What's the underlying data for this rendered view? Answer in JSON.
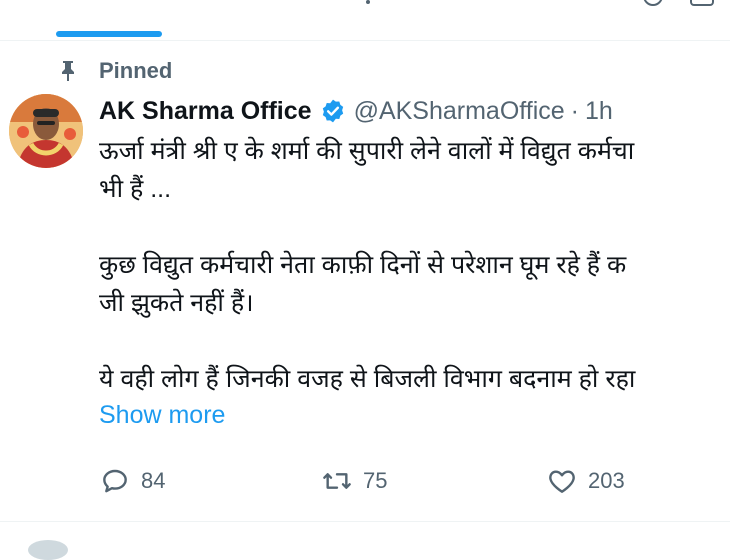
{
  "pinned": {
    "label": "Pinned"
  },
  "author": {
    "display_name": "AK Sharma Office",
    "handle": "@AKSharmaOffice",
    "separator": "·",
    "time": "1h",
    "verified": true
  },
  "tweet": {
    "line1": "ऊर्जा मंत्री श्री ए के शर्मा की सुपारी लेने वालों में विद्युत कर्मचा",
    "line2": "भी हैं ...",
    "line3": "कुछ विद्युत कर्मचारी नेता काफ़ी दिनों से परेशान घूम रहे हैं क",
    "line4": "जी झुकते नहीं हैं।",
    "line5": "ये वही लोग हैं जिनकी वजह से बिजली विभाग बदनाम हो रहा",
    "show_more": "Show more"
  },
  "actions": {
    "replies": "84",
    "retweets": "75",
    "likes": "203"
  },
  "colors": {
    "accent": "#1d9bf0",
    "secondary_text": "#536471",
    "primary_text": "#0f1419"
  },
  "icons": [
    "pin-icon",
    "verified-icon",
    "reply-icon",
    "retweet-icon",
    "like-icon"
  ]
}
